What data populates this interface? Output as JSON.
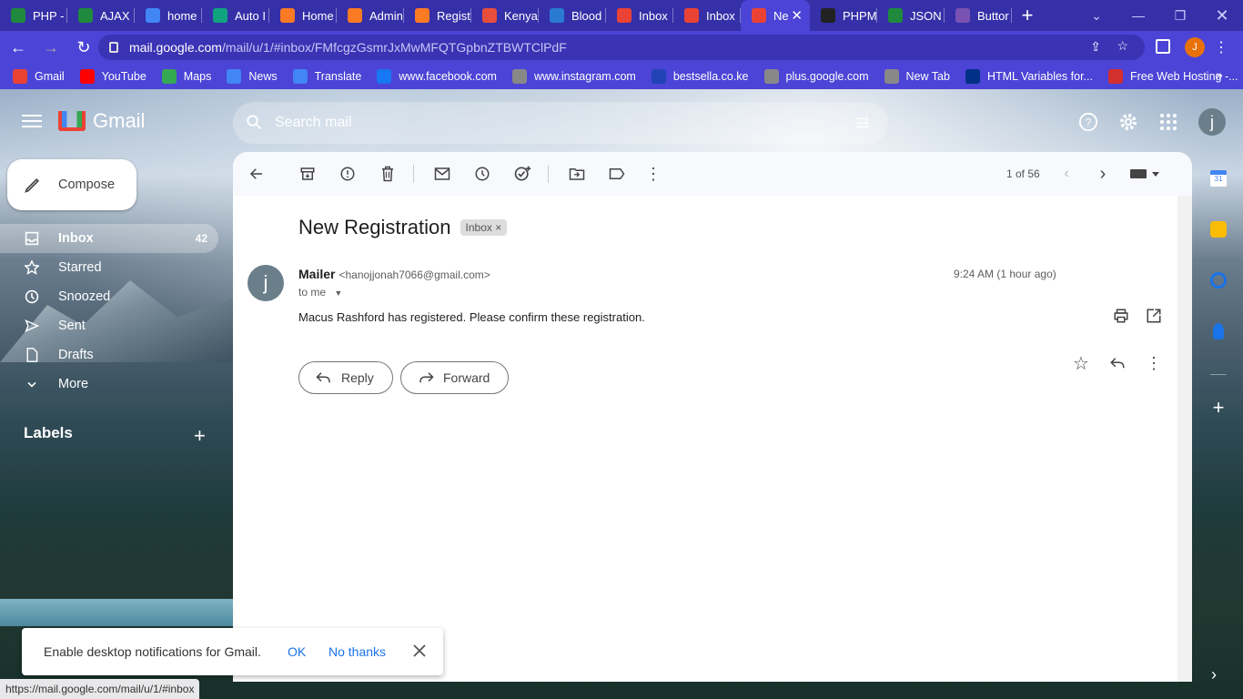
{
  "tabs": [
    {
      "title": "PHP -",
      "icon": "w-icon",
      "color": "#1f8a3e"
    },
    {
      "title": "AJAX",
      "icon": "w-icon",
      "color": "#1f8a3e"
    },
    {
      "title": "home",
      "icon": "google-icon",
      "color": "#4285f4"
    },
    {
      "title": "Auto I",
      "icon": "openai-icon",
      "color": "#10a37f"
    },
    {
      "title": "Home",
      "icon": "xampp-icon",
      "color": "#fb7a24"
    },
    {
      "title": "Admin",
      "icon": "xampp-icon",
      "color": "#fb7a24"
    },
    {
      "title": "Regist",
      "icon": "xampp-icon",
      "color": "#fb7a24"
    },
    {
      "title": "Kenya",
      "icon": "kenya-icon",
      "color": "#e94e3c"
    },
    {
      "title": "Blood",
      "icon": "blood-icon",
      "color": "#2a7ad1"
    },
    {
      "title": "Inbox",
      "icon": "gmail-icon",
      "color": "#ea4335"
    },
    {
      "title": "Inbox",
      "icon": "gmail-icon",
      "color": "#ea4335"
    },
    {
      "title": "Ne",
      "icon": "gmail-icon",
      "color": "#ea4335",
      "active": true
    },
    {
      "title": "PHPM",
      "icon": "github-icon",
      "color": "#222"
    },
    {
      "title": "JSON",
      "icon": "w-icon",
      "color": "#1f8a3e"
    },
    {
      "title": "Buttor",
      "icon": "bootstrap-icon",
      "color": "#7952b3"
    }
  ],
  "address": {
    "host": "mail.google.com",
    "path": "/mail/u/1/#inbox/FMfcgzGsmrJxMwMFQTGpbnZTBWTClPdF",
    "profile_initial": "J"
  },
  "bookmarks": [
    {
      "label": "Gmail",
      "icon": "gmail-icon",
      "color": "#ea4335"
    },
    {
      "label": "YouTube",
      "icon": "youtube-icon",
      "color": "#ff0000"
    },
    {
      "label": "Maps",
      "icon": "maps-icon",
      "color": "#34a853"
    },
    {
      "label": "News",
      "icon": "news-icon",
      "color": "#4285f4"
    },
    {
      "label": "Translate",
      "icon": "translate-icon",
      "color": "#4285f4"
    },
    {
      "label": "www.facebook.com",
      "icon": "facebook-icon",
      "color": "#1877f2"
    },
    {
      "label": "www.instagram.com",
      "icon": "globe-icon",
      "color": "#888"
    },
    {
      "label": "bestsella.co.ke",
      "icon": "bestsella-icon",
      "color": "#2243b6"
    },
    {
      "label": "plus.google.com",
      "icon": "globe-icon",
      "color": "#888"
    },
    {
      "label": "New Tab",
      "icon": "globe-icon",
      "color": "#888"
    },
    {
      "label": "HTML Variables for...",
      "icon": "paypal-icon",
      "color": "#003087"
    },
    {
      "label": "Free Web Hosting -...",
      "icon": "hosting-icon",
      "color": "#d32f2f"
    }
  ],
  "gmail": {
    "logo_text": "Gmail",
    "search_placeholder": "Search mail",
    "user_initial": "j",
    "compose_label": "Compose",
    "nav": [
      {
        "label": "Inbox",
        "count": "42",
        "icon": "inbox-icon",
        "selected": true
      },
      {
        "label": "Starred",
        "icon": "star-icon"
      },
      {
        "label": "Snoozed",
        "icon": "clock-icon"
      },
      {
        "label": "Sent",
        "icon": "send-icon"
      },
      {
        "label": "Drafts",
        "icon": "draft-icon"
      },
      {
        "label": "More",
        "icon": "chevron-down-icon"
      }
    ],
    "labels_title": "Labels",
    "pager": "1 of 56",
    "email": {
      "subject": "New Registration",
      "chip": "Inbox",
      "sender_name": "Mailer",
      "sender_email": "<hanojjonah7066@gmail.com>",
      "to": "to me",
      "time": "9:24 AM (1 hour ago)",
      "avatar_initial": "j",
      "body": "Macus Rashford has registered. Please confirm these registration."
    },
    "reply_label": "Reply",
    "forward_label": "Forward"
  },
  "toast": {
    "message": "Enable desktop notifications for Gmail.",
    "ok": "OK",
    "no_thanks": "No thanks"
  },
  "status_url": "https://mail.google.com/mail/u/1/#inbox"
}
